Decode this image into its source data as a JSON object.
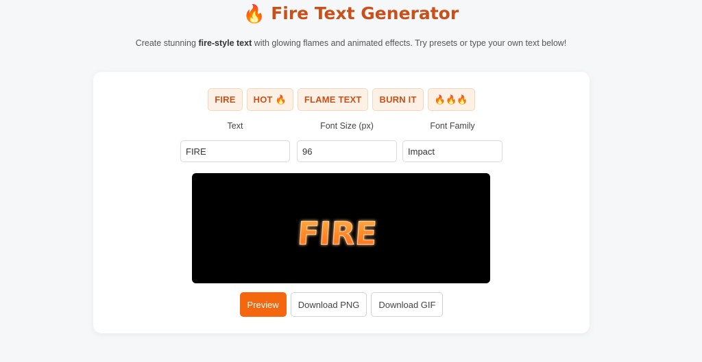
{
  "header": {
    "icon": "flame-icon",
    "icon_glyph": "🔥",
    "title": "Fire Text Generator"
  },
  "subtitle": {
    "before": "Create stunning ",
    "bold": "fire-style text",
    "after": " with glowing flames and animated effects. Try presets or type your own text below!"
  },
  "presets": [
    {
      "label": "FIRE"
    },
    {
      "label": "HOT 🔥"
    },
    {
      "label": "FLAME TEXT"
    },
    {
      "label": "BURN IT"
    },
    {
      "label": "🔥🔥🔥"
    }
  ],
  "fields": {
    "text": {
      "label": "Text",
      "value": "FIRE"
    },
    "font_size": {
      "label": "Font Size (px)",
      "value": "96"
    },
    "font_family": {
      "label": "Font Family",
      "value": "Impact"
    }
  },
  "preview": {
    "rendered_text": "FIRE",
    "background": "#000000",
    "glow_color": "#ff7a1a"
  },
  "actions": {
    "preview_label": "Preview",
    "download_png_label": "Download PNG",
    "download_gif_label": "Download GIF"
  },
  "colors": {
    "accent": "#f5670e",
    "title": "#c8501a",
    "preset_bg": "#fdf1e6"
  }
}
